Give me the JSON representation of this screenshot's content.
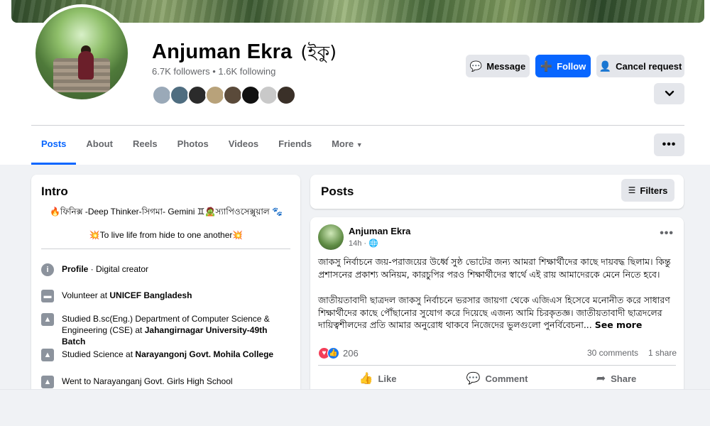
{
  "profile": {
    "name": "Anjuman Ekra",
    "nickname": "(ইকু)",
    "follow_stats": "6.7K followers • 1.6K following"
  },
  "actions": {
    "message": "Message",
    "follow": "Follow",
    "cancel_request": "Cancel request"
  },
  "tabs": [
    "Posts",
    "About",
    "Reels",
    "Photos",
    "Videos",
    "Friends",
    "More"
  ],
  "friend_avatar_colors": [
    "#9aa9b8",
    "#4f6d80",
    "#2b2b2b",
    "#b8a27a",
    "#5a4a3a",
    "#111111",
    "#c9c9c9",
    "#3a3028"
  ],
  "intro": {
    "title": "Intro",
    "bio_line1": "🔥ফিনিক্স -Deep Thinker-সিগমা- Gemini ♊🧟স্যাপিওসেক্সুয়াল 🐾",
    "bio_line2": "💥To live life from hide to one another💥",
    "items": [
      {
        "prefix": "",
        "bold": "Profile",
        "suffix": " · Digital creator"
      },
      {
        "prefix": "Volunteer at ",
        "bold": "UNICEF Bangladesh",
        "suffix": ""
      },
      {
        "prefix": "Studied B.sc(Eng.) Department of Computer Science & Engineering (CSE) at ",
        "bold": "Jahangirnagar University-49th Batch",
        "suffix": ""
      },
      {
        "prefix": "Studied Science at ",
        "bold": "Narayangonj Govt. Mohila College",
        "suffix": ""
      },
      {
        "prefix": "Went to Narayanganj Govt. Girls High School",
        "bold": "",
        "suffix": ""
      }
    ]
  },
  "posts_section": {
    "title": "Posts",
    "filters": "Filters"
  },
  "post": {
    "author": "Anjuman Ekra",
    "time": "14h · 🌐",
    "text_p1": "জাকসু নির্বাচনে জয়-পরাজয়ের উর্ধ্বে সুষ্ঠ ভোটের জন্য আমরা শিক্ষার্থীদের কাছে দায়বদ্ধ ছিলাম। কিন্তু প্রশাসনের প্রকাশ্য অনিয়ম, কারচুপির পরও শিক্ষার্থীদের স্বার্থে এই রায় আমাদেরকে মেনে নিতে হবে।",
    "text_p2": "জাতীয়তাবাদী ছাত্রদল জাকসু নির্বাচনে ভরসার জায়গা থেকে এজিএস হিসেবে মনোনীত করে সাধারণ শিক্ষার্থীদের কাছে পৌঁছানোর সুযোগ করে দিয়েছে এজন্য আমি চিরকৃতজ্ঞ। জাতীয়তাবাদী ছাত্রদলের দায়িত্বশীলদের প্রতি আমার অনুরোধ থাকবে নিজেদের ভুলগুলো পুনর্বিবেচনা...",
    "see_more": "See more",
    "reaction_count": "206",
    "comments": "30 comments",
    "shares": "1 share",
    "like": "Like",
    "comment": "Comment",
    "share": "Share"
  },
  "colors": {
    "accent": "#0866ff",
    "secondary_text": "#65676b",
    "button_gray": "#e4e6eb"
  }
}
